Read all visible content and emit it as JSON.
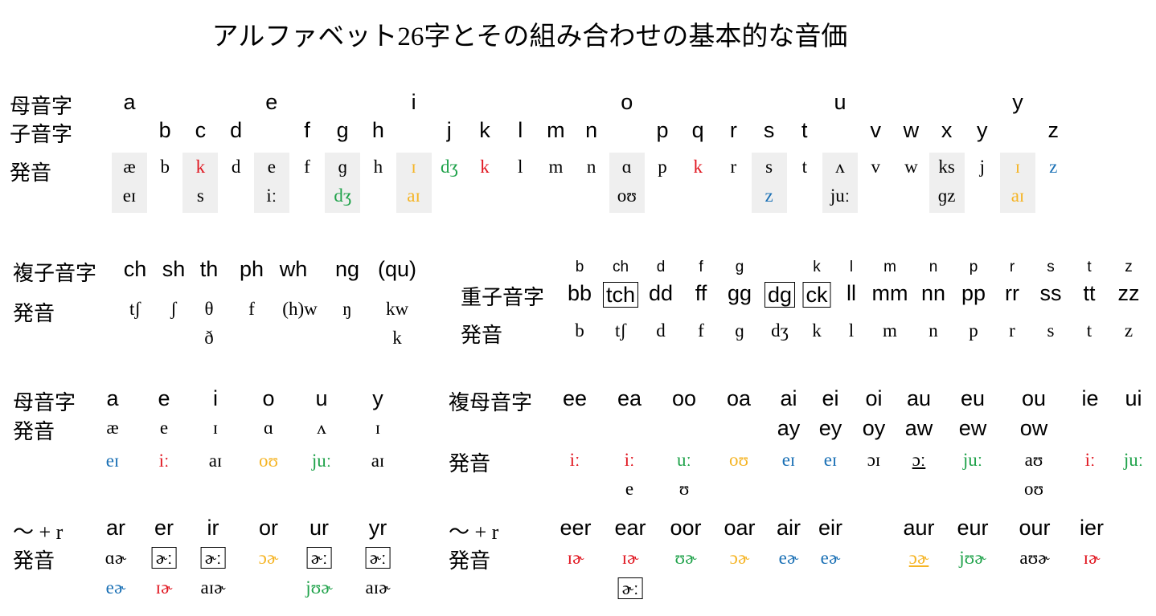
{
  "title": "アルファベット26字とその組み合わせの基本的な音価",
  "colors": {
    "red": "#e0151f",
    "green": "#1fa24a",
    "blue": "#1a70b5",
    "orange": "#f5b424",
    "black": "#000000",
    "shade": "#efefef"
  },
  "section1": {
    "vowel_label": "母音字",
    "consonant_label": "子音字",
    "pron_label": "発音",
    "columns": [
      {
        "vowel": "a",
        "consonant": "",
        "ipa": [
          "æ",
          "eɪ"
        ],
        "colors": [
          "black",
          "black"
        ],
        "shaded": true
      },
      {
        "vowel": "",
        "consonant": "b",
        "ipa": [
          "b"
        ],
        "colors": [
          "black"
        ],
        "shaded": false
      },
      {
        "vowel": "",
        "consonant": "c",
        "ipa": [
          "k",
          "s"
        ],
        "colors": [
          "red",
          "black"
        ],
        "shaded": true
      },
      {
        "vowel": "",
        "consonant": "d",
        "ipa": [
          "d"
        ],
        "colors": [
          "black"
        ],
        "shaded": false
      },
      {
        "vowel": "e",
        "consonant": "",
        "ipa": [
          "e",
          "iː"
        ],
        "colors": [
          "black",
          "black"
        ],
        "shaded": true
      },
      {
        "vowel": "",
        "consonant": "f",
        "ipa": [
          "f"
        ],
        "colors": [
          "black"
        ],
        "shaded": false
      },
      {
        "vowel": "",
        "consonant": "g",
        "ipa": [
          "ɡ",
          "dʒ"
        ],
        "colors": [
          "black",
          "green"
        ],
        "shaded": true
      },
      {
        "vowel": "",
        "consonant": "h",
        "ipa": [
          "h"
        ],
        "colors": [
          "black"
        ],
        "shaded": false
      },
      {
        "vowel": "i",
        "consonant": "",
        "ipa": [
          "ɪ",
          "aɪ"
        ],
        "colors": [
          "orange",
          "orange"
        ],
        "shaded": true
      },
      {
        "vowel": "",
        "consonant": "j",
        "ipa": [
          "dʒ"
        ],
        "colors": [
          "green"
        ],
        "shaded": false
      },
      {
        "vowel": "",
        "consonant": "k",
        "ipa": [
          "k"
        ],
        "colors": [
          "red"
        ],
        "shaded": false
      },
      {
        "vowel": "",
        "consonant": "l",
        "ipa": [
          "l"
        ],
        "colors": [
          "black"
        ],
        "shaded": false
      },
      {
        "vowel": "",
        "consonant": "m",
        "ipa": [
          "m"
        ],
        "colors": [
          "black"
        ],
        "shaded": false
      },
      {
        "vowel": "",
        "consonant": "n",
        "ipa": [
          "n"
        ],
        "colors": [
          "black"
        ],
        "shaded": false
      },
      {
        "vowel": "o",
        "consonant": "",
        "ipa": [
          "ɑ",
          "oʊ"
        ],
        "colors": [
          "black",
          "black"
        ],
        "shaded": true
      },
      {
        "vowel": "",
        "consonant": "p",
        "ipa": [
          "p"
        ],
        "colors": [
          "black"
        ],
        "shaded": false
      },
      {
        "vowel": "",
        "consonant": "q",
        "ipa": [
          "k"
        ],
        "colors": [
          "red"
        ],
        "shaded": false
      },
      {
        "vowel": "",
        "consonant": "r",
        "ipa": [
          "r"
        ],
        "colors": [
          "black"
        ],
        "shaded": false
      },
      {
        "vowel": "",
        "consonant": "s",
        "ipa": [
          "s",
          "z"
        ],
        "colors": [
          "black",
          "blue"
        ],
        "shaded": true
      },
      {
        "vowel": "",
        "consonant": "t",
        "ipa": [
          "t"
        ],
        "colors": [
          "black"
        ],
        "shaded": false
      },
      {
        "vowel": "u",
        "consonant": "",
        "ipa": [
          "ʌ",
          "juː"
        ],
        "colors": [
          "black",
          "black"
        ],
        "shaded": true
      },
      {
        "vowel": "",
        "consonant": "v",
        "ipa": [
          "v"
        ],
        "colors": [
          "black"
        ],
        "shaded": false
      },
      {
        "vowel": "",
        "consonant": "w",
        "ipa": [
          "w"
        ],
        "colors": [
          "black"
        ],
        "shaded": false
      },
      {
        "vowel": "",
        "consonant": "x",
        "ipa": [
          "ks",
          "ɡz"
        ],
        "colors": [
          "black",
          "black"
        ],
        "shaded": true
      },
      {
        "vowel": "",
        "consonant": "y",
        "ipa": [
          "j"
        ],
        "colors": [
          "black"
        ],
        "shaded": false
      },
      {
        "vowel": "y",
        "consonant": "",
        "ipa": [
          "ɪ",
          "aɪ"
        ],
        "colors": [
          "orange",
          "orange"
        ],
        "shaded": true
      },
      {
        "vowel": "",
        "consonant": "z",
        "ipa": [
          "z"
        ],
        "colors": [
          "blue"
        ],
        "shaded": false
      }
    ]
  },
  "digraphs": {
    "label": "複子音字",
    "pron_label": "発音",
    "items": [
      {
        "letters": "ch",
        "ipa": [
          "tʃ"
        ]
      },
      {
        "letters": "sh",
        "ipa": [
          "ʃ"
        ]
      },
      {
        "letters": "th",
        "ipa": [
          "θ",
          "ð"
        ]
      },
      {
        "letters": "ph",
        "ipa": [
          "f"
        ]
      },
      {
        "letters": "wh",
        "ipa": [
          "(h)w"
        ]
      },
      {
        "letters": "ng",
        "ipa": [
          "ŋ"
        ]
      },
      {
        "letters": "(qu)",
        "ipa": [
          "kw",
          "k"
        ]
      }
    ]
  },
  "doubles": {
    "label": "重子音字",
    "pron_label": "発音",
    "items": [
      {
        "top": "b",
        "letters": "bb",
        "boxed": false,
        "ipa": "b"
      },
      {
        "top": "ch",
        "letters": "tch",
        "boxed": true,
        "ipa": "tʃ"
      },
      {
        "top": "d",
        "letters": "dd",
        "boxed": false,
        "ipa": "d"
      },
      {
        "top": "f",
        "letters": "ff",
        "boxed": false,
        "ipa": "f"
      },
      {
        "top": "g",
        "letters": "gg",
        "boxed": false,
        "ipa": "ɡ"
      },
      {
        "top": "",
        "letters": "dg",
        "boxed": true,
        "ipa": "dʒ"
      },
      {
        "top": "k",
        "letters": "ck",
        "boxed": true,
        "ipa": "k"
      },
      {
        "top": "l",
        "letters": "ll",
        "boxed": false,
        "ipa": "l"
      },
      {
        "top": "m",
        "letters": "mm",
        "boxed": false,
        "ipa": "m"
      },
      {
        "top": "n",
        "letters": "nn",
        "boxed": false,
        "ipa": "n"
      },
      {
        "top": "p",
        "letters": "pp",
        "boxed": false,
        "ipa": "p"
      },
      {
        "top": "r",
        "letters": "rr",
        "boxed": false,
        "ipa": "r"
      },
      {
        "top": "s",
        "letters": "ss",
        "boxed": false,
        "ipa": "s"
      },
      {
        "top": "t",
        "letters": "tt",
        "boxed": false,
        "ipa": "t"
      },
      {
        "top": "z",
        "letters": "zz",
        "boxed": false,
        "ipa": "z"
      }
    ]
  },
  "vowels": {
    "label": "母音字",
    "pron_label": "発音",
    "items": [
      {
        "letter": "a",
        "short": "æ",
        "long": "eɪ",
        "long_color": "blue"
      },
      {
        "letter": "e",
        "short": "e",
        "long": "iː",
        "long_color": "red"
      },
      {
        "letter": "i",
        "short": "ɪ",
        "long": "aɪ",
        "long_color": "black"
      },
      {
        "letter": "o",
        "short": "ɑ",
        "long": "oʊ",
        "long_color": "orange"
      },
      {
        "letter": "u",
        "short": "ʌ",
        "long": "juː",
        "long_color": "green"
      },
      {
        "letter": "y",
        "short": "ɪ",
        "long": "aɪ",
        "long_color": "black"
      }
    ]
  },
  "vowel_digraphs": {
    "label": "複母音字",
    "pron_label": "発音",
    "items": [
      {
        "letters": "ee",
        "alt": "",
        "ipa": "iː",
        "color": "red",
        "ipa2": ""
      },
      {
        "letters": "ea",
        "alt": "",
        "ipa": "iː",
        "color": "red",
        "ipa2": "e"
      },
      {
        "letters": "oo",
        "alt": "",
        "ipa": "uː",
        "color": "green",
        "ipa2": "ʊ"
      },
      {
        "letters": "oa",
        "alt": "",
        "ipa": "oʊ",
        "color": "orange",
        "ipa2": ""
      },
      {
        "letters": "ai",
        "alt": "ay",
        "ipa": "eɪ",
        "color": "blue",
        "ipa2": ""
      },
      {
        "letters": "ei",
        "alt": "ey",
        "ipa": "eɪ",
        "color": "blue",
        "ipa2": ""
      },
      {
        "letters": "oi",
        "alt": "oy",
        "ipa": "ɔɪ",
        "color": "black",
        "ipa2": ""
      },
      {
        "letters": "au",
        "alt": "aw",
        "ipa": "ɔː",
        "color": "black",
        "ipa2": "",
        "underline": true
      },
      {
        "letters": "eu",
        "alt": "ew",
        "ipa": "juː",
        "color": "green",
        "ipa2": ""
      },
      {
        "letters": "ou",
        "alt": "ow",
        "ipa": "aʊ",
        "color": "black",
        "ipa2": "oʊ"
      },
      {
        "letters": "ie",
        "alt": "",
        "ipa": "iː",
        "color": "red",
        "ipa2": ""
      },
      {
        "letters": "ui",
        "alt": "",
        "ipa": "juː",
        "color": "green",
        "ipa2": ""
      }
    ]
  },
  "r_vowels": {
    "label": "〜 + r",
    "pron_label": "発音",
    "items": [
      {
        "letters": "ar",
        "ipa": "ɑɚ",
        "color": "black",
        "boxed": false,
        "ipa2": "eɚ",
        "color2": "blue"
      },
      {
        "letters": "er",
        "ipa": "ɚː",
        "color": "black",
        "boxed": true,
        "ipa2": "ɪɚ",
        "color2": "red"
      },
      {
        "letters": "ir",
        "ipa": "ɚː",
        "color": "black",
        "boxed": true,
        "ipa2": "aɪɚ",
        "color2": "black"
      },
      {
        "letters": "or",
        "ipa": "ɔɚ",
        "color": "orange",
        "boxed": false,
        "ipa2": "",
        "color2": "black"
      },
      {
        "letters": "ur",
        "ipa": "ɚː",
        "color": "black",
        "boxed": true,
        "ipa2": "jʊɚ",
        "color2": "green"
      },
      {
        "letters": "yr",
        "ipa": "ɚː",
        "color": "black",
        "boxed": true,
        "ipa2": "aɪɚ",
        "color2": "black"
      }
    ]
  },
  "r_vowel_digraphs": {
    "label": "〜 + r",
    "pron_label": "発音",
    "items": [
      {
        "letters": "eer",
        "ipa": "ɪɚ",
        "color": "red",
        "ipa2": "",
        "boxed2": false
      },
      {
        "letters": "ear",
        "ipa": "ɪɚ",
        "color": "red",
        "ipa2": "ɚː",
        "boxed2": true
      },
      {
        "letters": "oor",
        "ipa": "ʊɚ",
        "color": "green",
        "ipa2": "",
        "boxed2": false
      },
      {
        "letters": "oar",
        "ipa": "ɔɚ",
        "color": "orange",
        "ipa2": "",
        "boxed2": false
      },
      {
        "letters": "air",
        "ipa": "eɚ",
        "color": "blue",
        "ipa2": "",
        "boxed2": false
      },
      {
        "letters": "eir",
        "ipa": "eɚ",
        "color": "blue",
        "ipa2": "",
        "boxed2": false
      },
      {
        "letters": "aur",
        "ipa": "ɔɚ",
        "color": "orange",
        "ipa2": "",
        "boxed2": false,
        "underline": true
      },
      {
        "letters": "eur",
        "ipa": "jʊɚ",
        "color": "green",
        "ipa2": "",
        "boxed2": false
      },
      {
        "letters": "our",
        "ipa": "aʊɚ",
        "color": "black",
        "ipa2": "",
        "boxed2": false
      },
      {
        "letters": "ier",
        "ipa": "ɪɚ",
        "color": "red",
        "ipa2": "",
        "boxed2": false
      }
    ]
  }
}
